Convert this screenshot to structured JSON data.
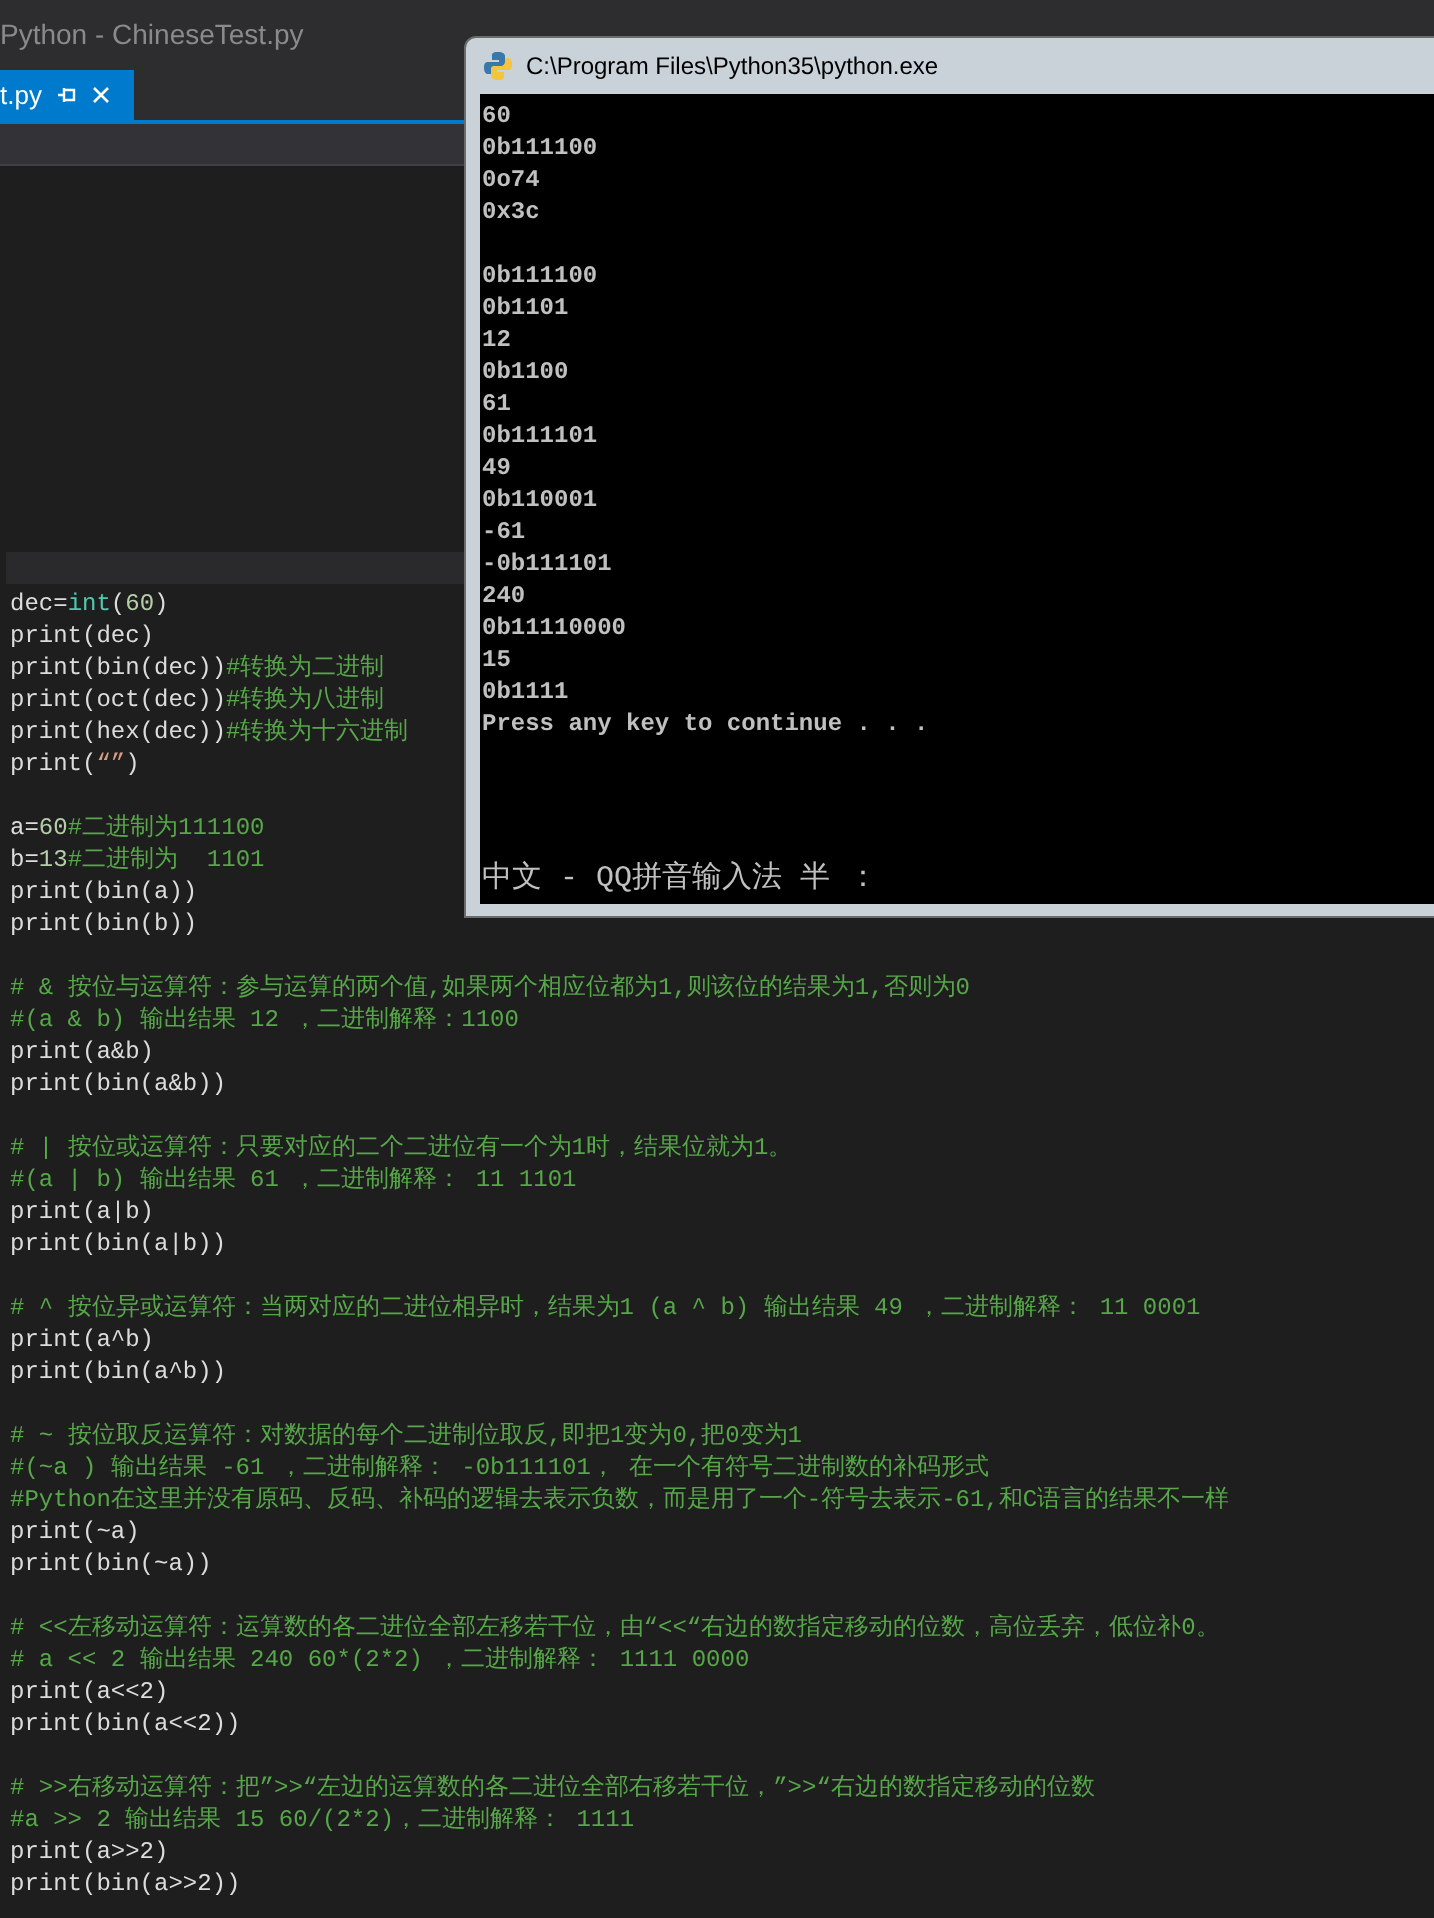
{
  "window": {
    "title": "Python - ChineseTest.py"
  },
  "tabs": [
    {
      "label": "t.py",
      "selected": true
    }
  ],
  "code_lines": [
    {
      "kind": "code",
      "segments": [
        {
          "kind": "plain",
          "text": "dec="
        },
        {
          "kind": "builtin",
          "text": "int"
        },
        {
          "kind": "plain",
          "text": "("
        },
        {
          "kind": "number",
          "text": "60"
        },
        {
          "kind": "plain",
          "text": ")"
        }
      ]
    },
    {
      "kind": "code",
      "segments": [
        {
          "kind": "plain",
          "text": "print(dec)"
        }
      ]
    },
    {
      "kind": "code",
      "segments": [
        {
          "kind": "plain",
          "text": "print(bin(dec))"
        },
        {
          "kind": "comment",
          "text": "#转换为二进制"
        }
      ]
    },
    {
      "kind": "code",
      "segments": [
        {
          "kind": "plain",
          "text": "print(oct(dec))"
        },
        {
          "kind": "comment",
          "text": "#转换为八进制"
        }
      ]
    },
    {
      "kind": "code",
      "segments": [
        {
          "kind": "plain",
          "text": "print(hex(dec))"
        },
        {
          "kind": "comment",
          "text": "#转换为十六进制"
        }
      ]
    },
    {
      "kind": "code",
      "segments": [
        {
          "kind": "plain",
          "text": "print("
        },
        {
          "kind": "string",
          "text": "“”"
        },
        {
          "kind": "plain",
          "text": ")"
        }
      ]
    },
    {
      "kind": "blank"
    },
    {
      "kind": "code",
      "segments": [
        {
          "kind": "plain",
          "text": "a="
        },
        {
          "kind": "number",
          "text": "60"
        },
        {
          "kind": "comment",
          "text": "#二进制为111100"
        }
      ]
    },
    {
      "kind": "code",
      "segments": [
        {
          "kind": "plain",
          "text": "b="
        },
        {
          "kind": "number",
          "text": "13"
        },
        {
          "kind": "comment",
          "text": "#二进制为  1101"
        }
      ]
    },
    {
      "kind": "code",
      "segments": [
        {
          "kind": "plain",
          "text": "print(bin(a))"
        }
      ]
    },
    {
      "kind": "code",
      "segments": [
        {
          "kind": "plain",
          "text": "print(bin(b))"
        }
      ]
    },
    {
      "kind": "blank"
    },
    {
      "kind": "code",
      "segments": [
        {
          "kind": "comment",
          "text": "# & 按位与运算符：参与运算的两个值,如果两个相应位都为1,则该位的结果为1,否则为0"
        }
      ]
    },
    {
      "kind": "code",
      "segments": [
        {
          "kind": "comment",
          "text": "#(a & b) 输出结果 12 ，二进制解释：1100"
        }
      ]
    },
    {
      "kind": "code",
      "segments": [
        {
          "kind": "plain",
          "text": "print(a&b)"
        }
      ]
    },
    {
      "kind": "code",
      "segments": [
        {
          "kind": "plain",
          "text": "print(bin(a&b))"
        }
      ]
    },
    {
      "kind": "blank"
    },
    {
      "kind": "code",
      "segments": [
        {
          "kind": "comment",
          "text": "# | 按位或运算符：只要对应的二个二进位有一个为1时，结果位就为1。"
        }
      ]
    },
    {
      "kind": "code",
      "segments": [
        {
          "kind": "comment",
          "text": "#(a | b) 输出结果 61 ，二进制解释： 11 1101"
        }
      ]
    },
    {
      "kind": "code",
      "segments": [
        {
          "kind": "plain",
          "text": "print(a|b)"
        }
      ]
    },
    {
      "kind": "code",
      "segments": [
        {
          "kind": "plain",
          "text": "print(bin(a|b))"
        }
      ]
    },
    {
      "kind": "blank"
    },
    {
      "kind": "code",
      "segments": [
        {
          "kind": "comment",
          "text": "# ^ 按位异或运算符：当两对应的二进位相异时，结果为1 (a ^ b) 输出结果 49 ，二进制解释： 11 0001"
        }
      ]
    },
    {
      "kind": "code",
      "segments": [
        {
          "kind": "plain",
          "text": "print(a^b)"
        }
      ]
    },
    {
      "kind": "code",
      "segments": [
        {
          "kind": "plain",
          "text": "print(bin(a^b))"
        }
      ]
    },
    {
      "kind": "blank"
    },
    {
      "kind": "code",
      "segments": [
        {
          "kind": "comment",
          "text": "# ~ 按位取反运算符：对数据的每个二进制位取反,即把1变为0,把0变为1"
        }
      ]
    },
    {
      "kind": "code",
      "segments": [
        {
          "kind": "comment",
          "text": "#(~a ) 输出结果 -61 ，二进制解释： -0b111101， 在一个有符号二进制数的补码形式"
        }
      ]
    },
    {
      "kind": "code",
      "segments": [
        {
          "kind": "comment",
          "text": "#Python在这里并没有原码、反码、补码的逻辑去表示负数，而是用了一个-符号去表示-61,和C语言的结果不一样"
        }
      ]
    },
    {
      "kind": "code",
      "segments": [
        {
          "kind": "plain",
          "text": "print(~a)"
        }
      ]
    },
    {
      "kind": "code",
      "segments": [
        {
          "kind": "plain",
          "text": "print(bin(~a))"
        }
      ]
    },
    {
      "kind": "blank"
    },
    {
      "kind": "code",
      "segments": [
        {
          "kind": "comment",
          "text": "# <<左移动运算符：运算数的各二进位全部左移若干位，由“<<“右边的数指定移动的位数，高位丢弃，低位补0。"
        }
      ]
    },
    {
      "kind": "code",
      "segments": [
        {
          "kind": "comment",
          "text": "# a << 2 输出结果 240 60*(2*2) ，二进制解释： 1111 0000"
        }
      ]
    },
    {
      "kind": "code",
      "segments": [
        {
          "kind": "plain",
          "text": "print(a<<2)"
        }
      ]
    },
    {
      "kind": "code",
      "segments": [
        {
          "kind": "plain",
          "text": "print(bin(a<<2))"
        }
      ]
    },
    {
      "kind": "blank"
    },
    {
      "kind": "code",
      "segments": [
        {
          "kind": "comment",
          "text": "# >>右移动运算符：把”>>“左边的运算数的各二进位全部右移若干位，”>>“右边的数指定移动的位数"
        }
      ]
    },
    {
      "kind": "code",
      "segments": [
        {
          "kind": "comment",
          "text": "#a >> 2 输出结果 15 60/(2*2)，二进制解释： 1111"
        }
      ]
    },
    {
      "kind": "code",
      "segments": [
        {
          "kind": "plain",
          "text": "print(a>>2)"
        }
      ]
    },
    {
      "kind": "code",
      "segments": [
        {
          "kind": "plain",
          "text": "print(bin(a>>2))"
        }
      ]
    }
  ],
  "console": {
    "title": "C:\\Program Files\\Python35\\python.exe",
    "output_blocks": [
      [
        "60",
        "0b111100",
        "0o74",
        "0x3c"
      ],
      [
        "0b111100",
        "0b1101",
        "12",
        "0b1100",
        "61",
        "0b111101",
        "49",
        "0b110001",
        "-61",
        "-0b111101",
        "240",
        "0b11110000",
        "15",
        "0b1111",
        "Press any key to continue . . ."
      ]
    ],
    "ime_status": "中文 - QQ拼音输入法 半 ："
  }
}
